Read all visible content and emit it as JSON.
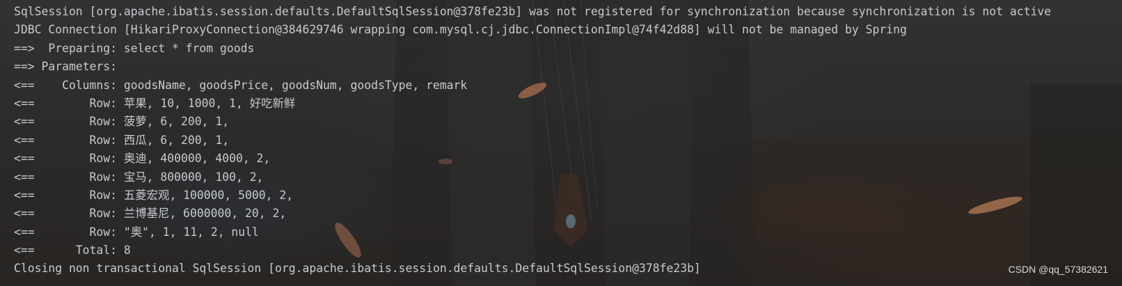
{
  "console": {
    "lines": [
      "SqlSession [org.apache.ibatis.session.defaults.DefaultSqlSession@378fe23b] was not registered for synchronization because synchronization is not active",
      "JDBC Connection [HikariProxyConnection@384629746 wrapping com.mysql.cj.jdbc.ConnectionImpl@74f42d88] will not be managed by Spring",
      "==>  Preparing: select * from goods",
      "==> Parameters: ",
      "<==    Columns: goodsName, goodsPrice, goodsNum, goodsType, remark",
      "<==        Row: 苹果, 10, 1000, 1, 好吃新鲜",
      "<==        Row: 菠萝, 6, 200, 1, ",
      "<==        Row: 西瓜, 6, 200, 1, ",
      "<==        Row: 奥迪, 400000, 4000, 2, ",
      "<==        Row: 宝马, 800000, 100, 2, ",
      "<==        Row: 五菱宏观, 100000, 5000, 2, ",
      "<==        Row: 兰博基尼, 6000000, 20, 2, ",
      "<==        Row: \"奥\", 1, 11, 2, null",
      "<==      Total: 8",
      "Closing non transactional SqlSession [org.apache.ibatis.session.defaults.DefaultSqlSession@378fe23b]"
    ]
  },
  "watermark": "CSDN @qq_57382621"
}
